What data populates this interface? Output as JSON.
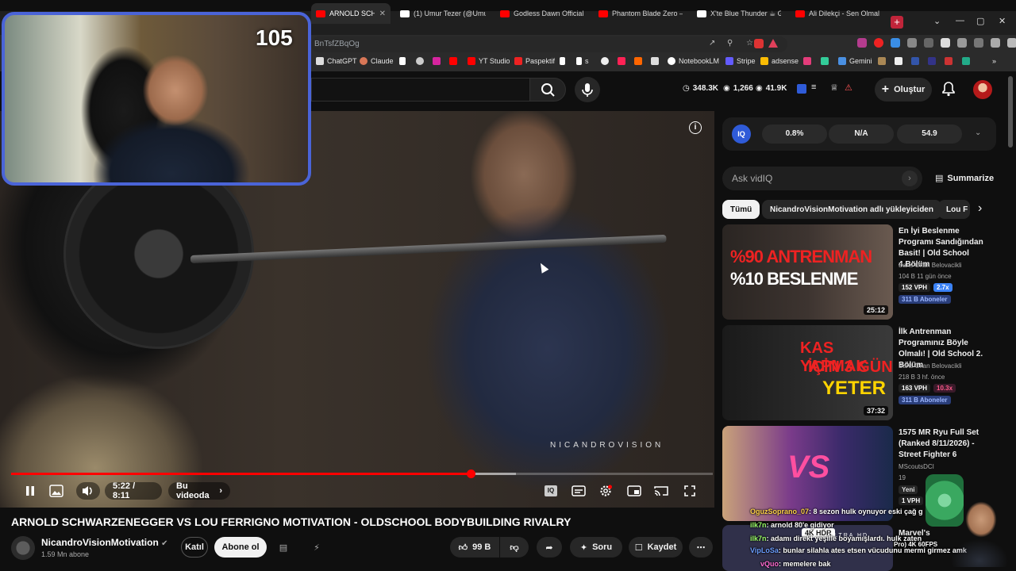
{
  "browser": {
    "tabs": [
      {
        "title": "ARNOLD SCHWAR",
        "color": "#ff0000",
        "active": true
      },
      {
        "title": "(1) Umur Tezer (@Umurte",
        "color": "#ffffff"
      },
      {
        "title": "Godless Dawn Official Cin",
        "color": "#ff0000"
      },
      {
        "title": "Phantom Blade Zero — P",
        "color": "#ff0000"
      },
      {
        "title": "X'te Blue Thunder ☕ GA",
        "color": "#ffffff"
      },
      {
        "title": "Ali Dilekçi - Sen Olmalısın",
        "color": "#ff0000"
      }
    ],
    "url_fragment": "BnTsfZBqOg",
    "bookmarks": [
      "ChatGPT",
      "Claude",
      "YT Studio",
      "Paspektif",
      "s",
      "NotebookLM",
      "Stripe",
      "adsense",
      "Gemini"
    ]
  },
  "header": {
    "stats": {
      "views": "348.3K",
      "subs": "1,266",
      "watch": "41.9K"
    },
    "create_label": "Oluştur"
  },
  "webcam": {
    "counter": "105"
  },
  "player": {
    "watermark": "NICANDROVISION",
    "time": "5:22 / 8:11",
    "in_video_label": "Bu videoda",
    "progress": 0.655,
    "buffered": 0.72,
    "info_glyph": "i"
  },
  "video": {
    "title": "ARNOLD SCHWARZENEGGER VS LOU FERRIGNO MOTIVATION - OLDSCHOOL BODYBUILDING RIVALRY",
    "channel": "NicandroVisionMotivation",
    "subs": "1.59 Mn abone",
    "join_label": "Katıl",
    "subscribe_label": "Abone ol",
    "likes": "99 B",
    "ask_label": "Soru",
    "save_label": "Kaydet"
  },
  "vidiq": {
    "badge": "IQ",
    "metrics": [
      "0.8%",
      "N/A",
      "54.9"
    ],
    "ask_placeholder": "Ask vidIQ",
    "summarize": "Summarize"
  },
  "chips": [
    "Tümü",
    "NicandroVisionMotivation adlı yükleyiciden",
    "Lou F"
  ],
  "recommendations": [
    {
      "title": "En İyi Beslenme Programı Sandığından Basit! | Old School 4.Bölüm",
      "channel": "Baris Okan Belovacikli",
      "meta": "104 B  11 gün önce",
      "vph": "152 VPH",
      "mult": "2.7x",
      "subs": "311 B Aboneler",
      "duration": "25:12",
      "thumb_text_1": "%90 ANTRENMAN",
      "thumb_text_2": "%10 BESLENME"
    },
    {
      "title": "İlk Antrenman Programınız Böyle Olmalı! | Old School 2. Bölüm",
      "channel": "Baris Okan Belovacikli",
      "meta": "218 B  3 hf. önce",
      "vph": "163 VPH",
      "mult": "10.3x",
      "subs": "311 B Aboneler",
      "duration": "37:32",
      "thumb_text_1": "KAS YAPMAK",
      "thumb_text_2": "İÇİN 3 GÜN",
      "thumb_text_3": "YETER"
    },
    {
      "title": "1575 MR Ryu Full Set (Ranked 8/11/2026) - Street Fighter 6",
      "channel": "MScoutsDCI",
      "meta": "19",
      "badge": "Yeni",
      "vph": "1 VPH",
      "thumb_text_1": "VS"
    },
    {
      "title": "Marvel's",
      "thumb_text_1": "4K HDR"
    }
  ],
  "chat": [
    {
      "user": "OguzSoprano_07",
      "text": ": 8 sezon hulk oynuyor eski çağ g",
      "color": "#ffd24a"
    },
    {
      "user": "ilk7n",
      "text": ": arnold 80'e gidiyor",
      "color": "#9dff6b"
    },
    {
      "user": "ilk7n",
      "text": ": adamı direkt yeşille boyamışlardı. hulk zaten",
      "color": "#9dff6b"
    },
    {
      "user": "VipLoSa",
      "text": ": bunlar silahla ates etsen vücudunu mermi girmez amk",
      "color": "#6b9dff"
    },
    {
      "user": "vQuo",
      "text": ": memelere bak",
      "color": "#ff6bd2"
    }
  ],
  "overlay_text": {
    "quality": "ULTRA HD",
    "pro": "Pro) 4K 60FPS",
    "hdr": "4K HDR"
  },
  "colors": {
    "accent": "#ff0000",
    "webcam_border": "#4a64d8",
    "vidiq": "#2f5bd8"
  }
}
